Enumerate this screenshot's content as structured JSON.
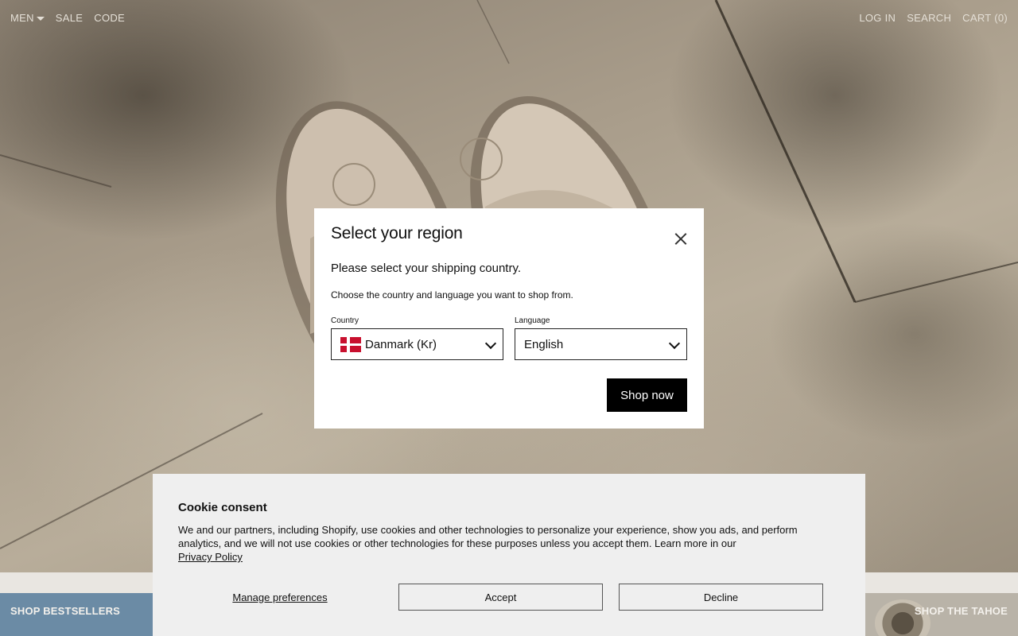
{
  "nav": {
    "left": [
      "MEN",
      "SALE",
      "CODE"
    ],
    "right": [
      "LOG IN",
      "SEARCH",
      "CART (0)"
    ]
  },
  "bands": {
    "left_label": "SHOP BESTSELLERS",
    "right_label": "SHOP THE TAHOE"
  },
  "region_modal": {
    "title": "Select your region",
    "subtitle": "Please select your shipping country.",
    "description": "Choose the country and language you want to shop from.",
    "country_label": "Country",
    "country_value": "Danmark (Kr)",
    "language_label": "Language",
    "language_value": "English",
    "shop_button": "Shop now"
  },
  "cookie": {
    "title": "Cookie consent",
    "body": "We and our partners, including Shopify, use cookies and other technologies to personalize your experience, show you ads, and perform analytics, and we will not use cookies or other technologies for these purposes unless you accept them. Learn more in our",
    "link": "Privacy Policy",
    "manage": "Manage preferences",
    "accept": "Accept",
    "decline": "Decline"
  },
  "colors": {
    "modal_bg": "#ffffff",
    "primary_button": "#000000",
    "cookie_bg": "#efefef",
    "flag_red": "#c8102e"
  }
}
